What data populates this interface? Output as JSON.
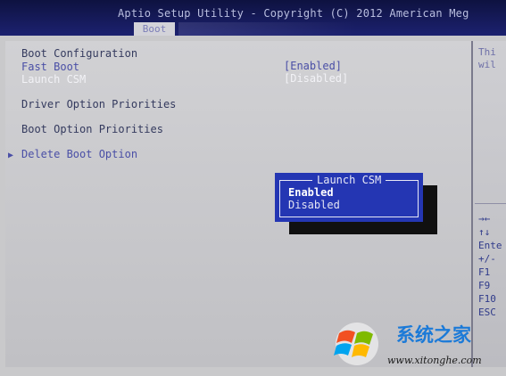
{
  "header": {
    "title": "Aptio Setup Utility - Copyright (C) 2012 American Meg",
    "active_tab": "Boot"
  },
  "main": {
    "section_title": "Boot Configuration",
    "fast_boot": {
      "label": "Fast Boot",
      "value": "[Enabled]"
    },
    "launch_csm": {
      "label": "Launch CSM",
      "value": "[Disabled]"
    },
    "driver_option_priorities": "Driver Option Priorities",
    "boot_option_priorities": "Boot Option Priorities",
    "delete_boot_option": "Delete Boot Option"
  },
  "popup": {
    "title": "Launch CSM",
    "options": [
      "Enabled",
      "Disabled"
    ],
    "selected": "Enabled"
  },
  "help": {
    "line1": "Thi",
    "line2": "wil",
    "keys": [
      "→←",
      "↑↓",
      "Ente",
      "+/-",
      "F1",
      "F9",
      "F10",
      "ESC"
    ]
  },
  "watermark": {
    "brand": "系统之家",
    "url": "www.xitonghe.com"
  },
  "colors": {
    "header_bg": "#1c2170",
    "popup_bg": "#2436b3",
    "body_bg": "#c9c9cb",
    "highlight_text": "#4a4fa6"
  },
  "icons": {
    "submenu_arrow": "triangle-right-icon",
    "windows_logo": "windows-logo-icon"
  }
}
